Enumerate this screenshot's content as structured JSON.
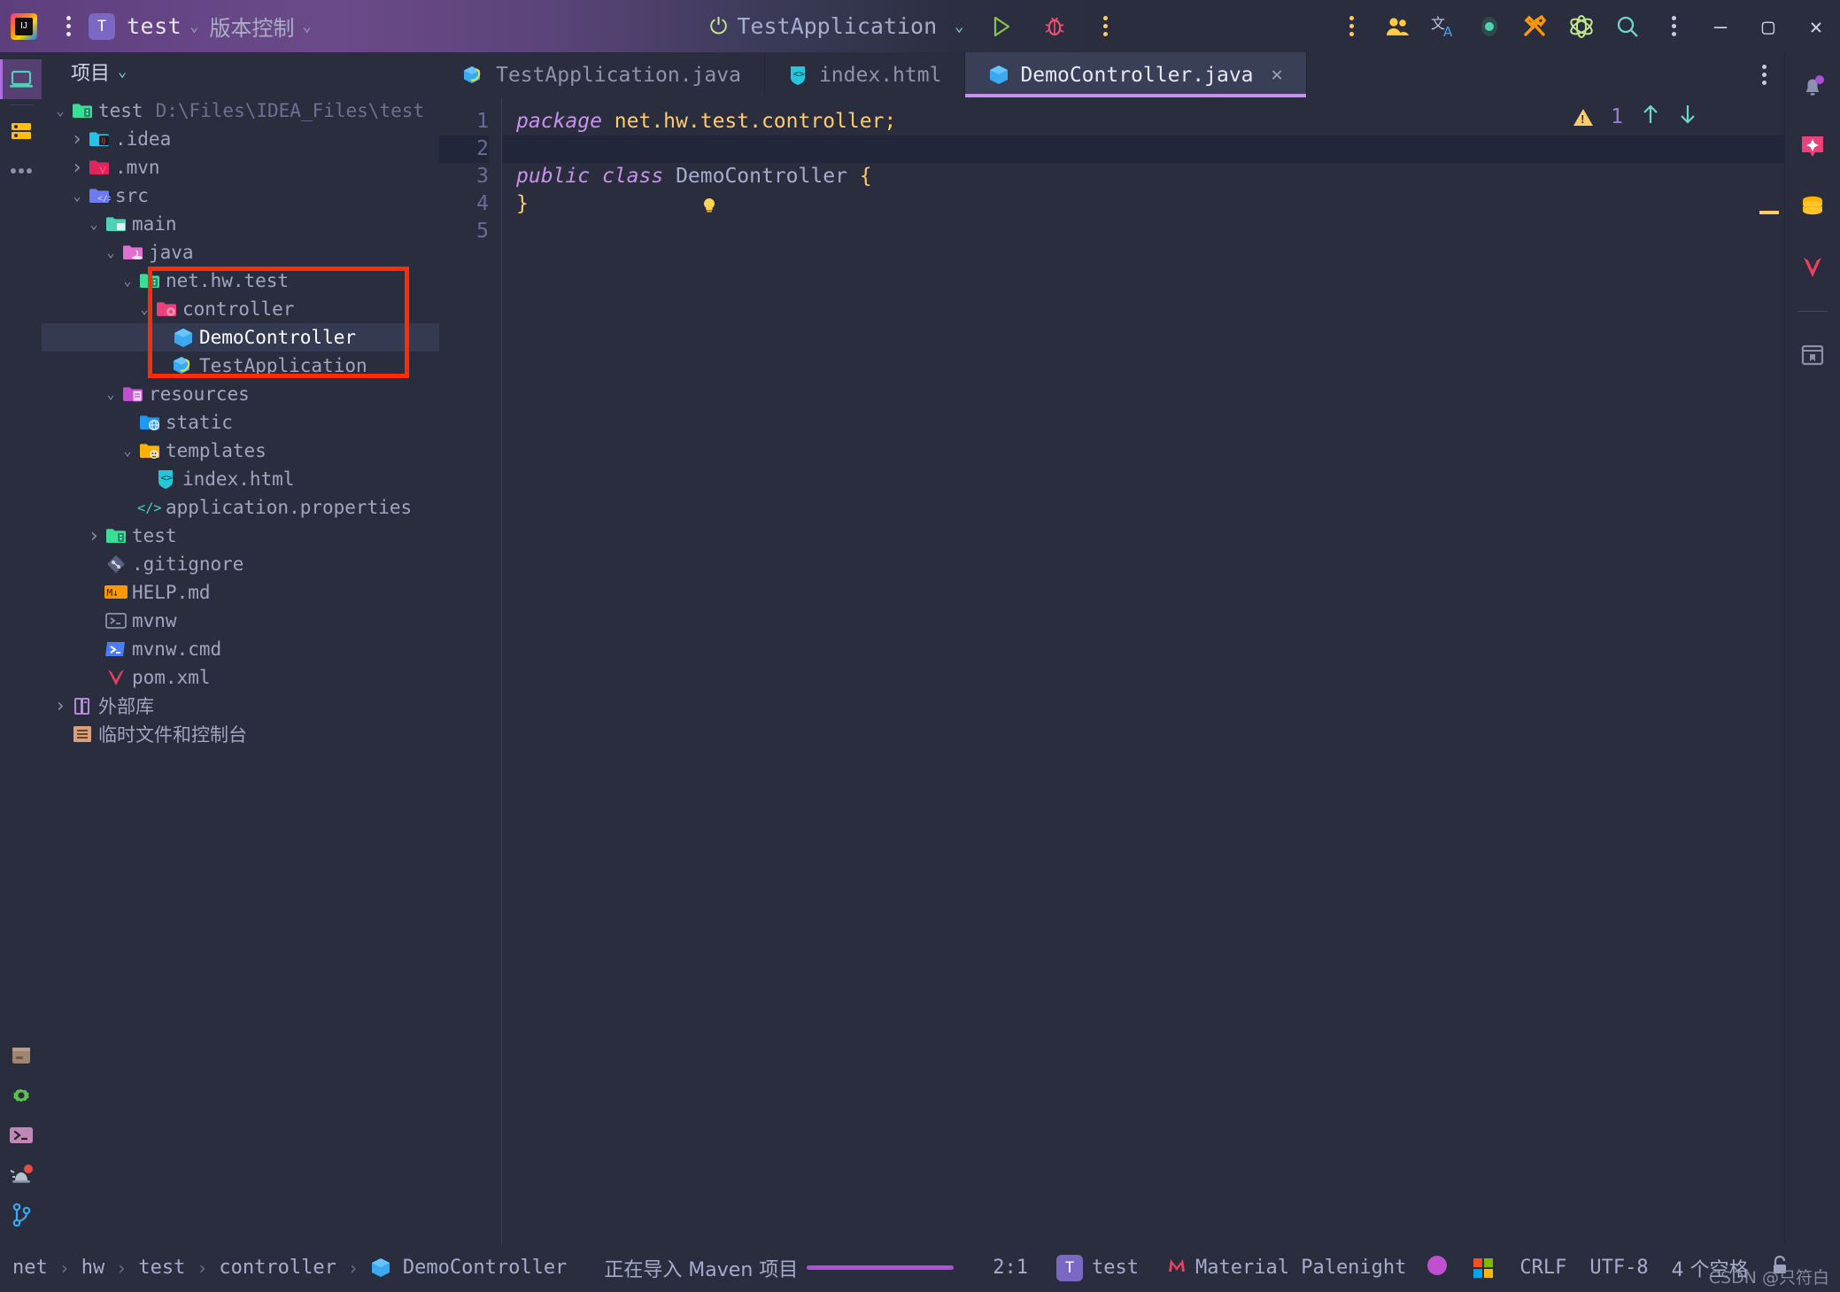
{
  "titlebar": {
    "logo_icon": "intellij-idea-logo",
    "menu_icon": "main-menu-kebab-icon",
    "project_badge": "T",
    "project_name": "test",
    "vcs_label": "版本控制",
    "run_config": "TestApplication",
    "power_icon": "power-icon",
    "run_icon": "run-icon",
    "debug_icon": "debug-bug-icon",
    "more_icon": "more-actions-kebab-icon",
    "right_icons": [
      {
        "name": "code-with-me-icon",
        "glyph": "users"
      },
      {
        "name": "translate-icon",
        "glyph": "translate"
      },
      {
        "name": "recording-indicator-icon",
        "glyph": "dot"
      },
      {
        "name": "tools-icon",
        "glyph": "tools"
      },
      {
        "name": "atom-plugin-icon",
        "glyph": "atom"
      },
      {
        "name": "search-everywhere-icon",
        "glyph": "search"
      },
      {
        "name": "settings-kebab-icon",
        "glyph": "kebab"
      }
    ],
    "window_minimize": "–",
    "window_maximize": "▢",
    "window_close": "✕"
  },
  "leftbar": {
    "items": [
      {
        "name": "project-tool-window-icon",
        "glyph": "laptop",
        "active": true
      },
      {
        "name": "services-tool-window-icon",
        "glyph": "server",
        "active": false
      },
      {
        "name": "more-tool-windows-icon",
        "glyph": "ellipsis",
        "active": false
      }
    ],
    "bottom_items": [
      {
        "name": "build-tool-window-icon",
        "glyph": "box"
      },
      {
        "name": "settings-sync-icon",
        "glyph": "gear"
      },
      {
        "name": "terminal-tool-window-icon",
        "glyph": "terminal"
      },
      {
        "name": "problems-tool-window-icon",
        "glyph": "alarm"
      },
      {
        "name": "version-control-tool-window-icon",
        "glyph": "branch"
      }
    ]
  },
  "project_panel": {
    "title": "项目",
    "tree": [
      {
        "label": "test",
        "path": "D:\\Files\\IDEA_Files\\test",
        "indent": 0,
        "arrow": "down",
        "icon": "project-root-folder-icon",
        "icon_color": "#3ddc97",
        "selected": false
      },
      {
        "label": ".idea",
        "path": "",
        "indent": 1,
        "arrow": "right",
        "icon": "idea-folder-icon",
        "icon_color": "#22c3e6",
        "selected": false
      },
      {
        "label": ".mvn",
        "path": "",
        "indent": 1,
        "arrow": "right",
        "icon": "maven-folder-icon",
        "icon_color": "#e0245e",
        "selected": false
      },
      {
        "label": "src",
        "path": "",
        "indent": 1,
        "arrow": "down",
        "icon": "source-folder-icon",
        "icon_color": "#6c7bf0",
        "selected": false
      },
      {
        "label": "main",
        "path": "",
        "indent": 2,
        "arrow": "down",
        "icon": "folder-icon",
        "icon_color": "#4fd1b5",
        "selected": false
      },
      {
        "label": "java",
        "path": "",
        "indent": 3,
        "arrow": "down",
        "icon": "java-source-folder-icon",
        "icon_color": "#e06fd0",
        "selected": false
      },
      {
        "label": "net.hw.test",
        "path": "",
        "indent": 4,
        "arrow": "down",
        "icon": "package-folder-icon",
        "icon_color": "#3ddc97",
        "selected": false
      },
      {
        "label": "controller",
        "path": "",
        "indent": 5,
        "arrow": "down",
        "icon": "controller-package-icon",
        "icon_color": "#ec407a",
        "selected": false
      },
      {
        "label": "DemoController",
        "path": "",
        "indent": 6,
        "arrow": "none",
        "icon": "java-class-icon",
        "icon_color": "#3aa9f0",
        "selected": true
      },
      {
        "label": "TestApplication",
        "path": "",
        "indent": 6,
        "arrow": "none",
        "icon": "spring-boot-class-icon",
        "icon_color": "#3aa9f0",
        "selected": false
      },
      {
        "label": "resources",
        "path": "",
        "indent": 3,
        "arrow": "down",
        "icon": "resources-folder-icon",
        "icon_color": "#c050d0",
        "selected": false
      },
      {
        "label": "static",
        "path": "",
        "indent": 4,
        "arrow": "none",
        "icon": "static-folder-icon",
        "icon_color": "#2196f3",
        "selected": false
      },
      {
        "label": "templates",
        "path": "",
        "indent": 4,
        "arrow": "down",
        "icon": "templates-folder-icon",
        "icon_color": "#ffb300",
        "selected": false
      },
      {
        "label": "index.html",
        "path": "",
        "indent": 5,
        "arrow": "none",
        "icon": "html-file-icon",
        "icon_color": "#26c6da",
        "selected": false
      },
      {
        "label": "application.properties",
        "path": "",
        "indent": 4,
        "arrow": "none",
        "icon": "properties-file-icon",
        "icon_color": "#4fd1b5",
        "selected": false
      },
      {
        "label": "test",
        "path": "",
        "indent": 2,
        "arrow": "right",
        "icon": "test-folder-icon",
        "icon_color": "#3ddc97",
        "selected": false
      },
      {
        "label": ".gitignore",
        "path": "",
        "indent": 2,
        "arrow": "none",
        "icon": "git-file-icon",
        "icon_color": "#6b7193",
        "selected": false
      },
      {
        "label": "HELP.md",
        "path": "",
        "indent": 2,
        "arrow": "none",
        "icon": "markdown-file-icon",
        "icon_color": "#ff9800",
        "selected": false
      },
      {
        "label": "mvnw",
        "path": "",
        "indent": 2,
        "arrow": "none",
        "icon": "shell-script-file-icon",
        "icon_color": "#8b95a8",
        "selected": false
      },
      {
        "label": "mvnw.cmd",
        "path": "",
        "indent": 2,
        "arrow": "none",
        "icon": "cmd-script-file-icon",
        "icon_color": "#4a7cf7",
        "selected": false
      },
      {
        "label": "pom.xml",
        "path": "",
        "indent": 2,
        "arrow": "none",
        "icon": "maven-pom-file-icon",
        "icon_color": "#ec4063",
        "selected": false
      },
      {
        "label": "外部库",
        "path": "",
        "indent": 0,
        "arrow": "right",
        "icon": "external-libraries-icon",
        "icon_color": "#c792ea",
        "selected": false,
        "cn": true
      },
      {
        "label": "临时文件和控制台",
        "path": "",
        "indent": 0,
        "arrow": "none",
        "icon": "scratches-consoles-icon",
        "icon_color": "#d9a07a",
        "selected": false,
        "cn": true
      }
    ]
  },
  "tabs": [
    {
      "label": "TestApplication.java",
      "icon": "spring-boot-class-icon",
      "active": false,
      "closable": false
    },
    {
      "label": "index.html",
      "icon": "html-file-icon",
      "active": false,
      "closable": false
    },
    {
      "label": "DemoController.java",
      "icon": "java-class-icon",
      "active": true,
      "closable": true,
      "close_glyph": "✕"
    }
  ],
  "tabbar": {
    "more_icon": "editor-tabs-kebab-icon"
  },
  "editor": {
    "lines": [
      {
        "num": "1",
        "current": false
      },
      {
        "num": "2",
        "current": true
      },
      {
        "num": "3",
        "current": false
      },
      {
        "num": "4",
        "current": false
      },
      {
        "num": "5",
        "current": false
      }
    ],
    "code": {
      "l1_kw": "package",
      "l1_pkg": "net.hw.test.controller;",
      "l3_kw1": "public",
      "l3_kw2": "class",
      "l3_name": "DemoController",
      "l3_brace": "{",
      "l4_brace": "}"
    },
    "bulb_icon": "intention-bulb-icon",
    "warning_count": "1",
    "warning_icon": "warning-triangle-icon",
    "prev_icon": "previous-highlight-icon",
    "next_icon": "next-highlight-icon"
  },
  "rightbar": {
    "items": [
      {
        "name": "notifications-bell-icon",
        "glyph": "bell"
      },
      {
        "name": "ai-assistant-icon",
        "glyph": "spark"
      },
      {
        "name": "database-icon",
        "glyph": "database"
      },
      {
        "name": "maven-tool-window-icon",
        "glyph": "maven"
      },
      {
        "name": "bookmarks-icon",
        "glyph": "book"
      }
    ]
  },
  "statusbar": {
    "breadcrumbs": [
      "net",
      "hw",
      "test",
      "controller",
      "DemoController"
    ],
    "breadcrumb_icon": "java-class-icon",
    "task_text": "正在导入 Maven 项目",
    "progress_percent": 100,
    "caret_position": "2:1",
    "project_badge": "T",
    "project_name": "test",
    "theme_icon": "material-theme-icon",
    "theme_name": "Material Palenight",
    "accent_dot_color": "#c050d0",
    "os_icon": "windows-logo-icon",
    "line_separator": "CRLF",
    "encoding": "UTF-8",
    "indent": "4 个空格",
    "lock_icon": "read-only-lock-icon",
    "watermark": "CSDN @只符白"
  },
  "colors": {
    "accent_purple": "#c792ea",
    "bg": "#292d3e",
    "selection": "#343a51",
    "redbox": "#ff2d00"
  }
}
